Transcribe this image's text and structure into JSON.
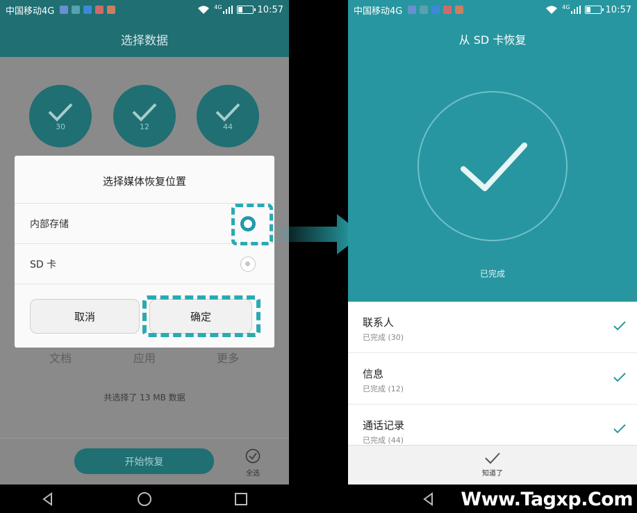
{
  "left": {
    "status": {
      "carrier": "中国移动4G",
      "network": "4G",
      "time": "10:57"
    },
    "header_title": "选择数据",
    "categories": [
      {
        "count": "30"
      },
      {
        "count": "12"
      },
      {
        "count": "44"
      }
    ],
    "category_labels": [
      "文档",
      "应用",
      "更多"
    ],
    "summary": "共选择了 13 MB 数据",
    "start_button": "开始恢复",
    "select_all": "全选",
    "dialog": {
      "title": "选择媒体恢复位置",
      "options": [
        {
          "label": "内部存储",
          "selected": true
        },
        {
          "label": "SD 卡",
          "selected": false
        }
      ],
      "cancel": "取消",
      "ok": "确定"
    }
  },
  "right": {
    "status": {
      "carrier": "中国移动4G",
      "network": "4G",
      "time": "10:57"
    },
    "header_title": "从 SD 卡恢复",
    "done_text": "已完成",
    "items": [
      {
        "name": "联系人",
        "status": "已完成 (30)"
      },
      {
        "name": "信息",
        "status": "已完成 (12)"
      },
      {
        "name": "通话记录",
        "status": "已完成 (44)"
      }
    ],
    "got_it": "知道了"
  },
  "watermark": "Www.Tagxp.Com",
  "colors": {
    "teal": "#2896a0",
    "teal_dark": "#1f6f73",
    "highlight": "#2aaab2"
  }
}
